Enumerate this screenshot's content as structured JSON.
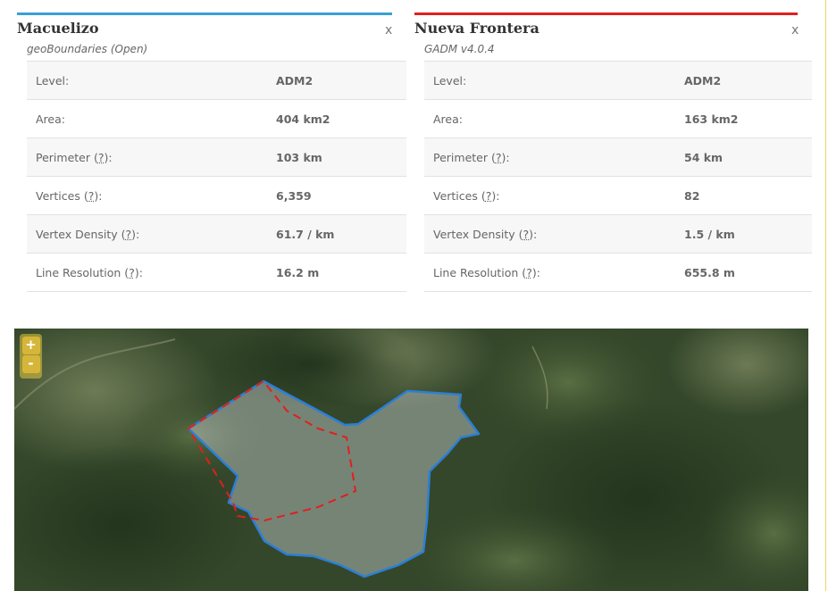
{
  "left_panel": {
    "title": "Macuelizo",
    "source": "geoBoundaries (Open)",
    "close_label": "x",
    "accent_color": "#3ba0d4",
    "rows": [
      {
        "label": "Level:",
        "value": "ADM2"
      },
      {
        "label": "Area:",
        "value": "404 km2"
      },
      {
        "label_prefix": "Perimeter (",
        "help": "?",
        "label_suffix": "):",
        "value": "103 km"
      },
      {
        "label_prefix": "Vertices (",
        "help": "?",
        "label_suffix": "):",
        "value": "6,359"
      },
      {
        "label_prefix": "Vertex Density (",
        "help": "?",
        "label_suffix": "):",
        "value": "61.7 / km"
      },
      {
        "label_prefix": "Line Resolution (",
        "help": "?",
        "label_suffix": "):",
        "value": "16.2 m"
      }
    ]
  },
  "right_panel": {
    "title": "Nueva Frontera",
    "source": "GADM v4.0.4",
    "close_label": "x",
    "accent_color": "#e01f1f",
    "rows": [
      {
        "label": "Level:",
        "value": "ADM2"
      },
      {
        "label": "Area:",
        "value": "163 km2"
      },
      {
        "label_prefix": "Perimeter (",
        "help": "?",
        "label_suffix": "):",
        "value": "54 km"
      },
      {
        "label_prefix": "Vertices (",
        "help": "?",
        "label_suffix": "):",
        "value": "82"
      },
      {
        "label_prefix": "Vertex Density (",
        "help": "?",
        "label_suffix": "):",
        "value": "1.5 / km"
      },
      {
        "label_prefix": "Line Resolution (",
        "help": "?",
        "label_suffix": "):",
        "value": "655.8 m"
      }
    ]
  },
  "map": {
    "zoom_in_label": "+",
    "zoom_out_label": "-",
    "boundary_a_color": "#2b7fd6",
    "boundary_b_color": "#e01f1f"
  }
}
